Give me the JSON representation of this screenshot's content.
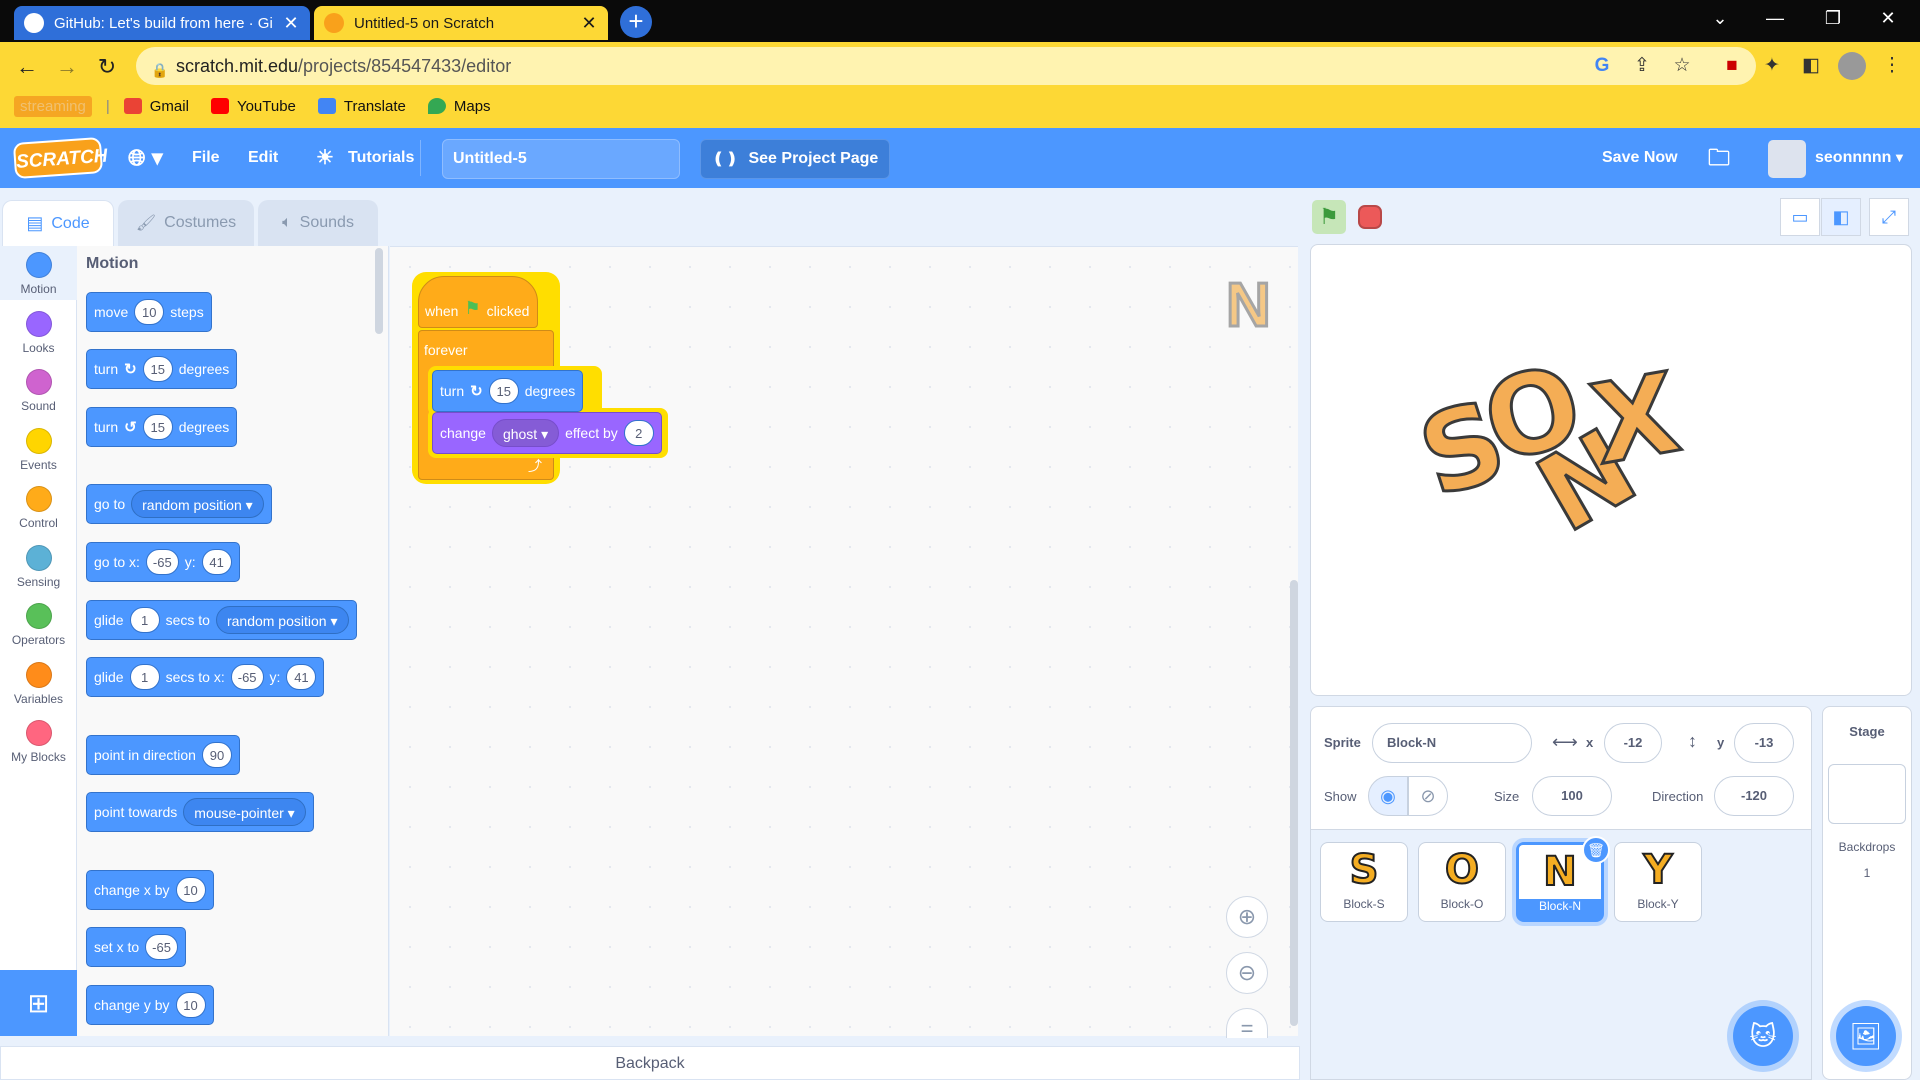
{
  "browser": {
    "tabs": [
      {
        "title": "GitHub: Let's build from here · Gi",
        "active": false
      },
      {
        "title": "Untitled-5 on Scratch",
        "active": true
      }
    ],
    "url_host": "scratch.mit.edu",
    "url_path": "/projects/854547433/editor",
    "bookmarks": [
      {
        "label": "streaming"
      },
      {
        "label": "Gmail"
      },
      {
        "label": "YouTube"
      },
      {
        "label": "Translate"
      },
      {
        "label": "Maps"
      }
    ]
  },
  "menubar": {
    "logo": "SCRATCH",
    "file": "File",
    "edit": "Edit",
    "tutorials": "Tutorials",
    "project_title": "Untitled-5",
    "see_project": "See Project Page",
    "save_now": "Save Now",
    "username": "seonnnnn"
  },
  "editor_tabs": {
    "code": "Code",
    "costumes": "Costumes",
    "sounds": "Sounds"
  },
  "categories": [
    {
      "label": "Motion",
      "color": "#4c97ff"
    },
    {
      "label": "Looks",
      "color": "#9966ff"
    },
    {
      "label": "Sound",
      "color": "#cf63cf"
    },
    {
      "label": "Events",
      "color": "#ffd500"
    },
    {
      "label": "Control",
      "color": "#ffab19"
    },
    {
      "label": "Sensing",
      "color": "#5cb1d6"
    },
    {
      "label": "Operators",
      "color": "#59c059"
    },
    {
      "label": "Variables",
      "color": "#ff8c1a"
    },
    {
      "label": "My Blocks",
      "color": "#ff6680"
    }
  ],
  "palette": {
    "title": "Motion",
    "move": {
      "w1": "move",
      "v1": "10",
      "w2": "steps"
    },
    "turn_right": {
      "w1": "turn",
      "v1": "15",
      "w2": "degrees"
    },
    "turn_left": {
      "w1": "turn",
      "v1": "15",
      "w2": "degrees"
    },
    "goto": {
      "w1": "go to",
      "dd": "random position"
    },
    "goto_xy": {
      "w1": "go to x:",
      "v1": "-65",
      "w2": "y:",
      "v2": "41"
    },
    "glide": {
      "w1": "glide",
      "v1": "1",
      "w2": "secs to",
      "dd": "random position"
    },
    "glide_xy": {
      "w1": "glide",
      "v1": "1",
      "w2": "secs to x:",
      "v2": "-65",
      "w3": "y:",
      "v3": "41"
    },
    "point_dir": {
      "w1": "point in direction",
      "v1": "90"
    },
    "point_towards": {
      "w1": "point towards",
      "dd": "mouse-pointer"
    },
    "change_x": {
      "w1": "change x by",
      "v1": "10"
    },
    "set_x": {
      "w1": "set x to",
      "v1": "-65"
    },
    "change_y": {
      "w1": "change y by",
      "v1": "10"
    }
  },
  "script": {
    "hat_when": "when",
    "hat_clicked": "clicked",
    "forever": "forever",
    "turn": {
      "w1": "turn",
      "v1": "15",
      "w2": "degrees"
    },
    "change": {
      "w1": "change",
      "dd": "ghost",
      "w2": "effect by",
      "v1": "2"
    }
  },
  "backpack": "Backpack",
  "sprite_info": {
    "sprite_label": "Sprite",
    "sprite_name": "Block-N",
    "x_label": "x",
    "x_value": "-12",
    "y_label": "y",
    "y_value": "-13",
    "show_label": "Show",
    "size_label": "Size",
    "size_value": "100",
    "direction_label": "Direction",
    "direction_value": "-120"
  },
  "sprites": [
    {
      "name": "Block-S",
      "glyph": "S",
      "selected": false
    },
    {
      "name": "Block-O",
      "glyph": "O",
      "selected": false
    },
    {
      "name": "Block-N",
      "glyph": "N",
      "selected": true
    },
    {
      "name": "Block-Y",
      "glyph": "Y",
      "selected": false
    }
  ],
  "stage_pane": {
    "title": "Stage",
    "backdrops_label": "Backdrops",
    "backdrops_count": "1"
  },
  "stage_letters": [
    "S",
    "O",
    "N",
    "X"
  ],
  "colors": {
    "scratch_blue": "#4c97ff",
    "motion": "#4c97ff",
    "looks": "#9966ff",
    "control": "#ffab19",
    "chrome_yellow": "#fdd835"
  }
}
